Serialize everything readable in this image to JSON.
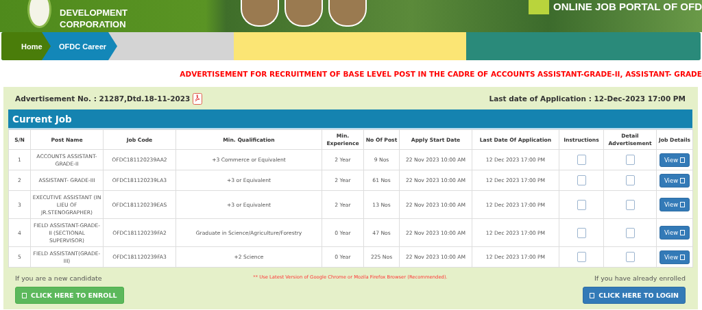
{
  "header": {
    "org_lines": [
      "DEVELOPMENT",
      "CORPORATION"
    ],
    "portal_title": "ONLINE JOB PORTAL OF OFD"
  },
  "breadcrumb": [
    {
      "label": "Home",
      "color": "#4a7d0a"
    },
    {
      "label": "OFDC Career",
      "color": "#1387b8"
    }
  ],
  "notice": "ADVERTISEMENT FOR RECRUITMENT OF BASE LEVEL POST IN THE CADRE OF ACCOUNTS ASSISTANT-GRADE-II, ASSISTANT- GRADE",
  "advertisement_no": "Advertisement No. : 21287,Dtd.18-11-2023",
  "last_date": "Last date of Application : 12-Dec-2023 17:00 PM",
  "table": {
    "title": "Current Job",
    "columns": [
      "S/N",
      "Post Name",
      "Job Code",
      "Min. Qualification",
      "Min. Experience",
      "No Of Post",
      "Apply Start Date",
      "Last Date Of Application",
      "Instructions",
      "Detail Advertisement",
      "Job Details"
    ],
    "rows": [
      {
        "sn": "1",
        "post_name": "ACCOUNTS ASSISTANT-GRADE-II",
        "job_code": "OFDC181120239AA2",
        "qualification": "+3 Commerce or Equivalent",
        "experience": "2 Year",
        "posts": "9 Nos",
        "start": "22 Nov 2023 10:00 AM",
        "last": "12 Dec 2023 17:00 PM",
        "instructions_checked": false,
        "detail_checked": false,
        "action": "View"
      },
      {
        "sn": "2",
        "post_name": "ASSISTANT- GRADE-III",
        "job_code": "OFDC181120239LA3",
        "qualification": "+3 or Equivalent",
        "experience": "2 Year",
        "posts": "61 Nos",
        "start": "22 Nov 2023 10:00 AM",
        "last": "12 Dec 2023 17:00 PM",
        "instructions_checked": false,
        "detail_checked": false,
        "action": "View"
      },
      {
        "sn": "3",
        "post_name": "EXECUTIVE ASSISTANT (IN LIEU OF JR.STENOGRAPHER)",
        "job_code": "OFDC181120239EAS",
        "qualification": "+3 or Equivalent",
        "experience": "2 Year",
        "posts": "13 Nos",
        "start": "22 Nov 2023 10:00 AM",
        "last": "12 Dec 2023 17:00 PM",
        "instructions_checked": false,
        "detail_checked": false,
        "action": "View"
      },
      {
        "sn": "4",
        "post_name": "FIELD ASSISTANT-GRADE-II (SECTIONAL SUPERVISOR)",
        "job_code": "OFDC181120239FA2",
        "qualification": "Graduate in Science/Agriculture/Forestry",
        "experience": "0 Year",
        "posts": "47 Nos",
        "start": "22 Nov 2023 10:00 AM",
        "last": "12 Dec 2023 17:00 PM",
        "instructions_checked": false,
        "detail_checked": false,
        "action": "View"
      },
      {
        "sn": "5",
        "post_name": "FIELD ASSISTANT(GRADE- III)",
        "job_code": "OFDC181120239FA3",
        "qualification": "+2 Science",
        "experience": "0 Year",
        "posts": "225 Nos",
        "start": "22 Nov 2023 10:00 AM",
        "last": "12 Dec 2023 17:00 PM",
        "instructions_checked": false,
        "detail_checked": false,
        "action": "View"
      }
    ]
  },
  "footer": {
    "new_candidate": "If you are a new candidate",
    "browser_note": "** Use Latest Version of Google Chrome or Mozila Firefox Browser (Recommended).",
    "enrolled": "If you have already enrolled",
    "enroll_button": "CLICK HERE TO ENROLL",
    "login_button": "CLICK HERE TO LOGIN"
  }
}
